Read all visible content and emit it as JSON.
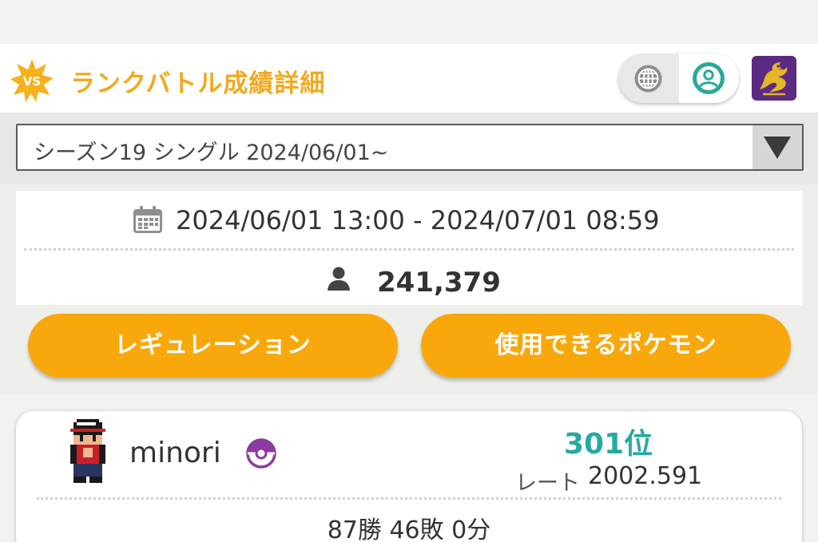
{
  "header": {
    "title": "ランクバトル成績詳細",
    "badge_text": "VS",
    "accent_color": "#f2a91e",
    "icons": [
      "vs-badge-icon",
      "globe-icon",
      "user-circle-icon",
      "game-title-icon"
    ]
  },
  "season_select": {
    "selected": "シーズン19 シングル 2024/06/01~"
  },
  "season_info": {
    "period": "2024/06/01 13:00 - 2024/07/01 08:59",
    "players": "241,379"
  },
  "buttons": {
    "regulation": "レギュレーション",
    "usable_pokemon": "使用できるポケモン",
    "color": "#f9a80c"
  },
  "player": {
    "name": "minori",
    "rank": "301位",
    "rate_label": "レート",
    "rate_value": "2002.591",
    "record": "87勝 46敗 0分",
    "rank_color": "#27a9a3"
  }
}
